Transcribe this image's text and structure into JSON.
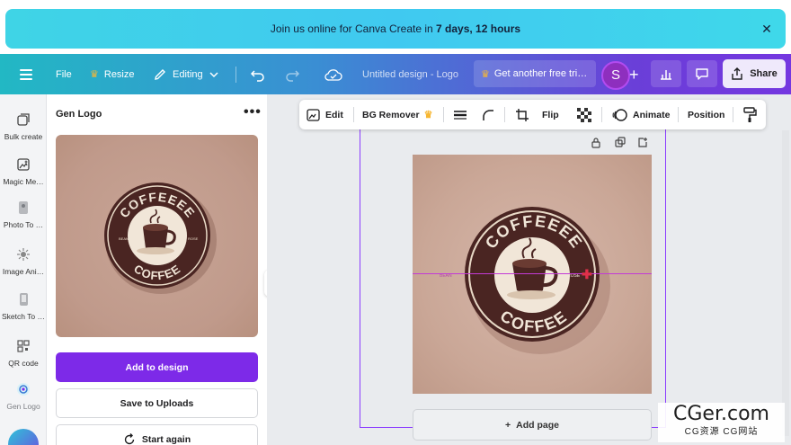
{
  "banner": {
    "prefix": "Join us online for Canva Create in ",
    "highlight": "7 days, 12 hours"
  },
  "topbar": {
    "file": "File",
    "resize": "Resize",
    "editing": "Editing",
    "doc_title": "Untitled design - Logo",
    "promo": "Get another free tri…",
    "avatar_initial": "S",
    "share": "Share"
  },
  "rail": [
    {
      "label": "Bulk create"
    },
    {
      "label": "Magic Me…"
    },
    {
      "label": "Photo To …"
    },
    {
      "label": "Image Ani…"
    },
    {
      "label": "Sketch To …"
    },
    {
      "label": "QR code"
    },
    {
      "label": "Gen Logo"
    }
  ],
  "panel": {
    "title": "Gen Logo",
    "add_to_design": "Add to design",
    "save_to_uploads": "Save to Uploads",
    "start_again": "Start again"
  },
  "toolbar": {
    "edit": "Edit",
    "bg_remover": "BG Remover",
    "flip": "Flip",
    "animate": "Animate",
    "position": "Position"
  },
  "logo": {
    "top_text": "COFFEEEE",
    "bottom_text": "COFFEE",
    "left_small": "BEAN",
    "right_small": "ROSE"
  },
  "canvas": {
    "add_page": "Add page"
  },
  "watermark": {
    "main": "CGer.com",
    "sub": "CG资源 CG网站"
  },
  "colors": {
    "primary": "#7d2ae8",
    "logo_dark": "#4a2522",
    "logo_cream": "#f1e6d8",
    "selection": "#8b3dff"
  }
}
